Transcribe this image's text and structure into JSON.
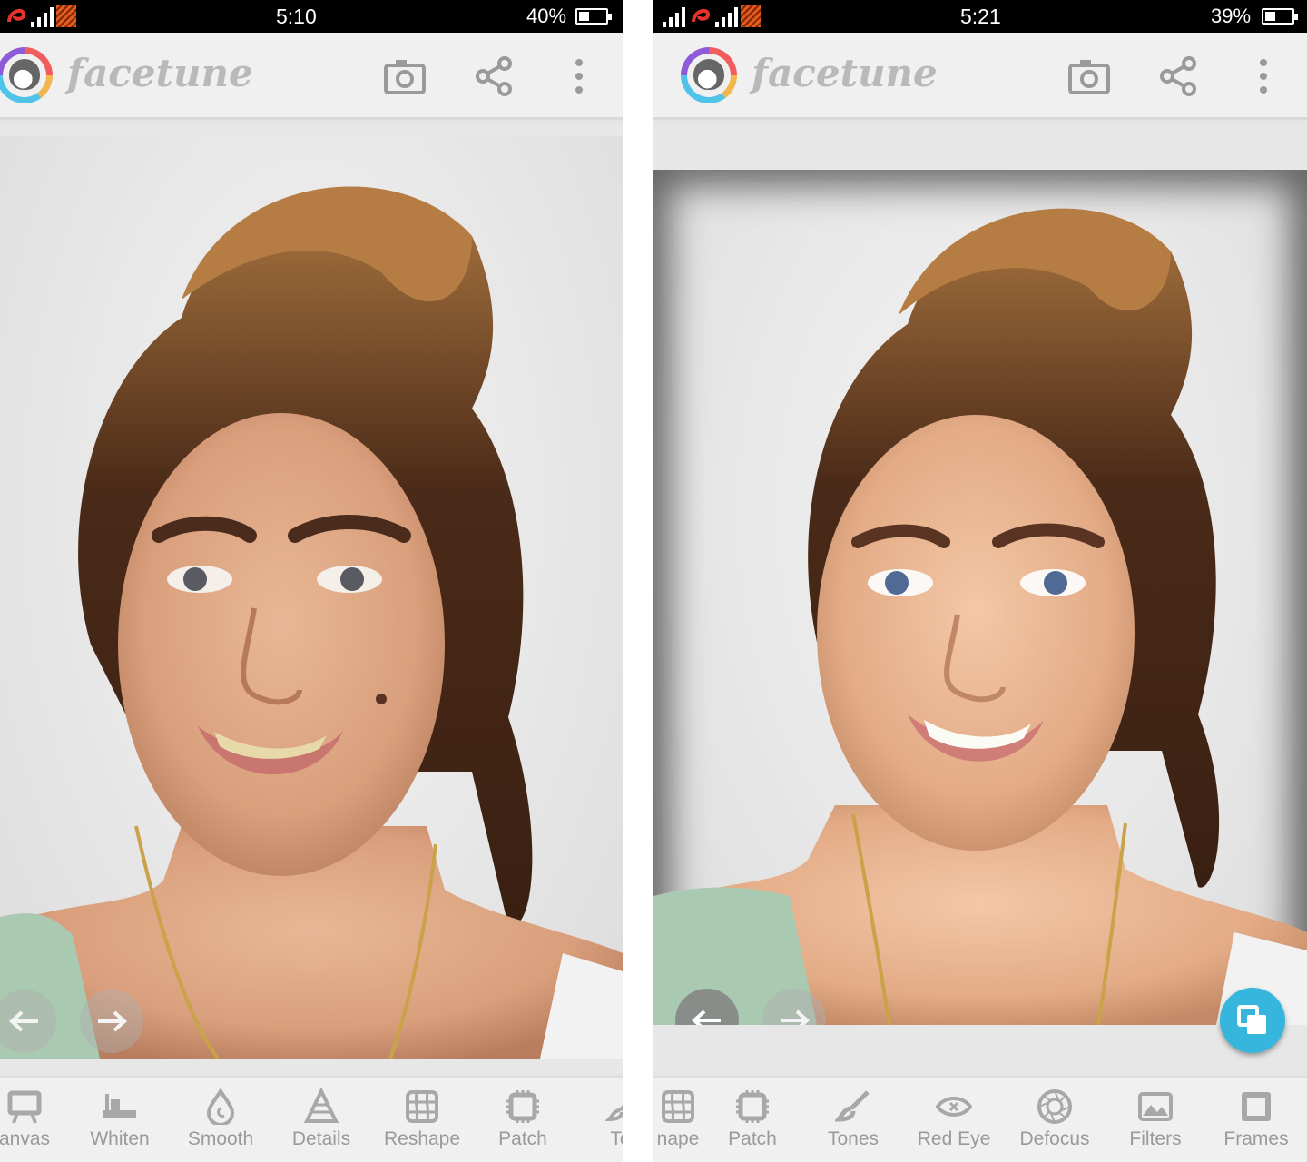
{
  "left_screen": {
    "status": {
      "time": "5:10",
      "battery_text": "40%",
      "battery_level": 0.4
    },
    "app_bar": {
      "brand": "facetune",
      "icons": [
        "camera-icon",
        "share-icon",
        "more-vert-icon"
      ]
    },
    "tools": [
      {
        "label": "anvas",
        "icon": "canvas-icon"
      },
      {
        "label": "Whiten",
        "icon": "whiten-icon"
      },
      {
        "label": "Smooth",
        "icon": "smooth-icon"
      },
      {
        "label": "Details",
        "icon": "details-icon"
      },
      {
        "label": "Reshape",
        "icon": "reshape-icon"
      },
      {
        "label": "Patch",
        "icon": "patch-icon"
      },
      {
        "label": "Tor",
        "icon": "tones-icon"
      }
    ]
  },
  "right_screen": {
    "status": {
      "time": "5:21",
      "battery_text": "39%",
      "battery_level": 0.39
    },
    "app_bar": {
      "brand": "facetune",
      "icons": [
        "camera-icon",
        "share-icon",
        "more-vert-icon"
      ]
    },
    "tools": [
      {
        "label": "nape",
        "icon": "reshape-icon"
      },
      {
        "label": "Patch",
        "icon": "patch-icon"
      },
      {
        "label": "Tones",
        "icon": "tones-icon"
      },
      {
        "label": "Red Eye",
        "icon": "red-eye-icon"
      },
      {
        "label": "Defocus",
        "icon": "defocus-icon"
      },
      {
        "label": "Filters",
        "icon": "filters-icon"
      },
      {
        "label": "Frames",
        "icon": "frames-icon"
      }
    ]
  },
  "colors": {
    "status_bar": "#000000",
    "app_bar": "#f0f0f0",
    "brand_text": "#b9b9b9",
    "tool_label": "#9a9a9a",
    "compare_button": "#36b6dc"
  }
}
